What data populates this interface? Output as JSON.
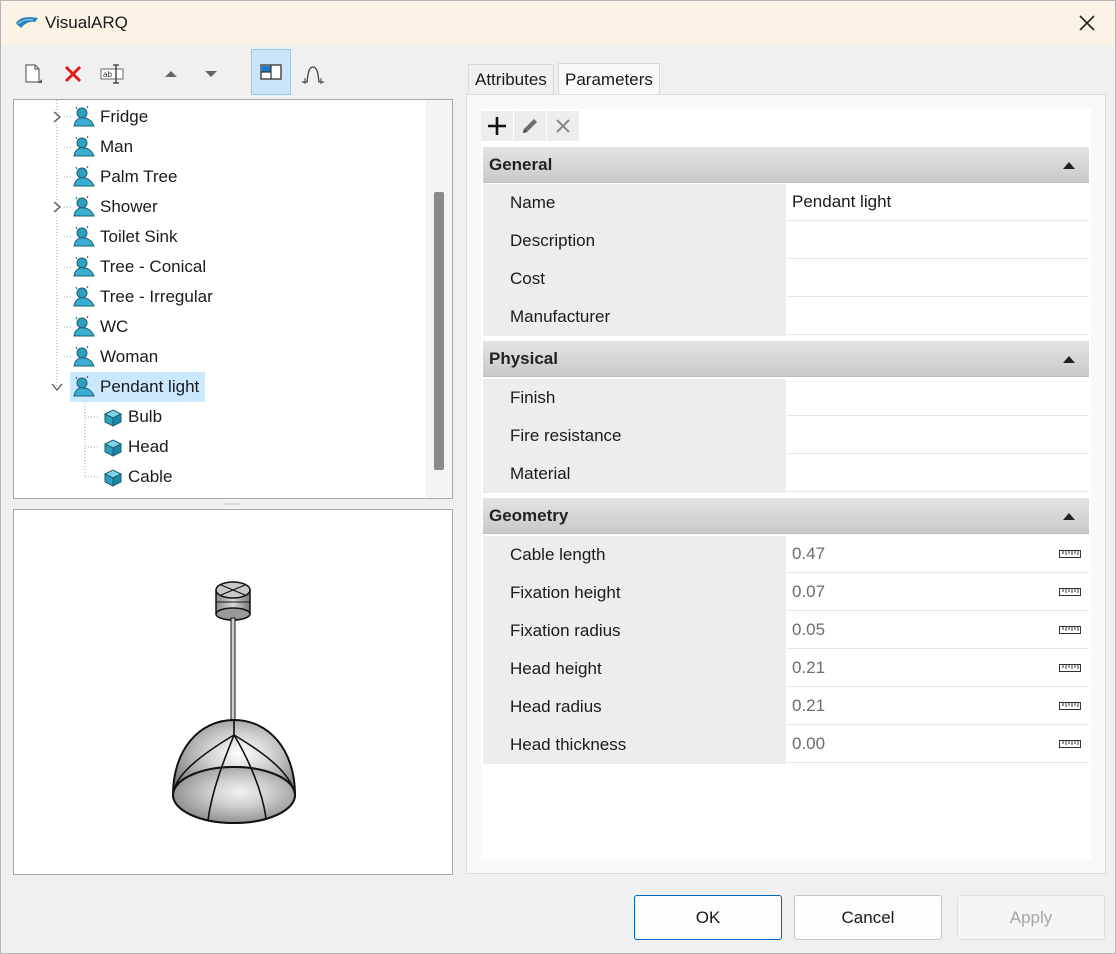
{
  "window": {
    "title": "VisualARQ"
  },
  "toolbar": {
    "icons": [
      "new-document-icon",
      "delete-icon",
      "rename-icon",
      "move-up-icon",
      "move-down-icon",
      "layout-view-icon",
      "curve-profile-icon"
    ]
  },
  "tree": {
    "items": [
      {
        "label": "Fridge",
        "expander": "collapsed",
        "kind": "group"
      },
      {
        "label": "Man",
        "expander": "none",
        "kind": "group"
      },
      {
        "label": "Palm Tree",
        "expander": "none",
        "kind": "group"
      },
      {
        "label": "Shower",
        "expander": "collapsed",
        "kind": "group"
      },
      {
        "label": "Toilet Sink",
        "expander": "none",
        "kind": "group"
      },
      {
        "label": "Tree - Conical",
        "expander": "none",
        "kind": "group"
      },
      {
        "label": "Tree - Irregular",
        "expander": "none",
        "kind": "group"
      },
      {
        "label": "WC",
        "expander": "none",
        "kind": "group"
      },
      {
        "label": "Woman",
        "expander": "none",
        "kind": "group"
      },
      {
        "label": "Pendant light",
        "expander": "expanded",
        "kind": "group",
        "selected": true
      },
      {
        "label": "Bulb",
        "expander": "none",
        "kind": "component"
      },
      {
        "label": "Head",
        "expander": "none",
        "kind": "component"
      },
      {
        "label": "Cable",
        "expander": "none",
        "kind": "component"
      }
    ]
  },
  "tabs": [
    {
      "label": "Attributes",
      "active": false
    },
    {
      "label": "Parameters",
      "active": true
    }
  ],
  "param_toolbar": {
    "icons": [
      "add-icon",
      "edit-icon",
      "remove-icon"
    ]
  },
  "sections": [
    {
      "title": "General",
      "rows": [
        {
          "name": "Name",
          "value": "Pendant light"
        },
        {
          "name": "Description",
          "value": ""
        },
        {
          "name": "Cost",
          "value": ""
        },
        {
          "name": "Manufacturer",
          "value": ""
        }
      ]
    },
    {
      "title": "Physical",
      "rows": [
        {
          "name": "Finish",
          "value": ""
        },
        {
          "name": "Fire resistance",
          "value": ""
        },
        {
          "name": "Material",
          "value": ""
        }
      ]
    },
    {
      "title": "Geometry",
      "rows": [
        {
          "name": "Cable length",
          "value": "0.47"
        },
        {
          "name": "Fixation height",
          "value": "0.07"
        },
        {
          "name": "Fixation radius",
          "value": "0.05"
        },
        {
          "name": "Head height",
          "value": "0.21"
        },
        {
          "name": "Head radius",
          "value": "0.21"
        },
        {
          "name": "Head thickness",
          "value": "0.00"
        }
      ]
    }
  ],
  "buttons": {
    "ok": "OK",
    "cancel": "Cancel",
    "apply": "Apply"
  },
  "colors": {
    "selection": "#cce8ff",
    "accent": "#0067c0",
    "title_bar": "#faf3e6"
  }
}
